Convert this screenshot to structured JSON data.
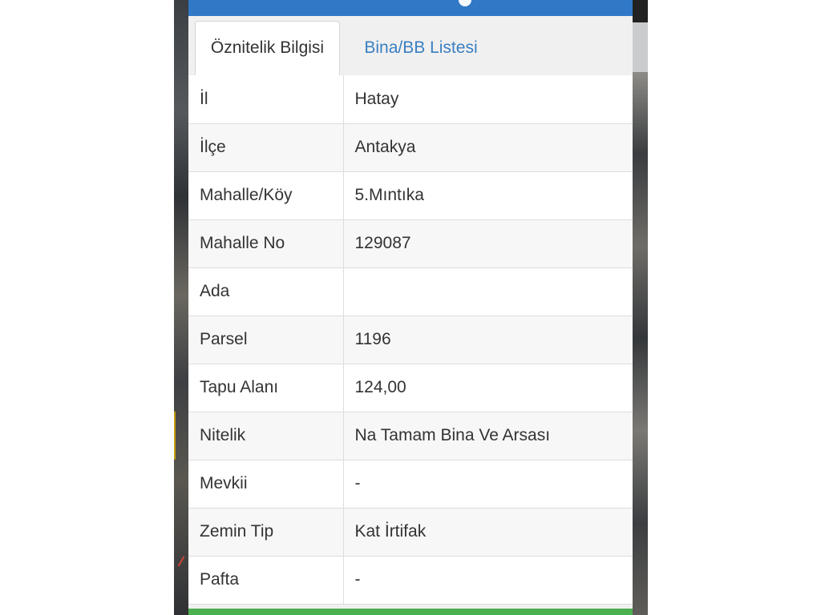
{
  "tabs": [
    {
      "label": "Öznitelik Bilgisi",
      "active": true
    },
    {
      "label": "Bina/BB Listesi",
      "active": false
    }
  ],
  "rows": [
    {
      "key": "İl",
      "value": "Hatay"
    },
    {
      "key": "İlçe",
      "value": "Antakya"
    },
    {
      "key": "Mahalle/Köy",
      "value": "5.Mıntıka"
    },
    {
      "key": "Mahalle No",
      "value": "129087"
    },
    {
      "key": "Ada",
      "value": ""
    },
    {
      "key": "Parsel",
      "value": "1196"
    },
    {
      "key": "Tapu Alanı",
      "value": "124,00"
    },
    {
      "key": "Nitelik",
      "value": "Na Tamam Bina Ve Arsası"
    },
    {
      "key": "Mevkii",
      "value": "-"
    },
    {
      "key": "Zemin Tip",
      "value": "Kat İrtifak"
    },
    {
      "key": "Pafta",
      "value": "-"
    }
  ],
  "colors": {
    "title_bar": "#3178c6",
    "link": "#3a7fc2",
    "bottom_bar": "#4caf50"
  }
}
